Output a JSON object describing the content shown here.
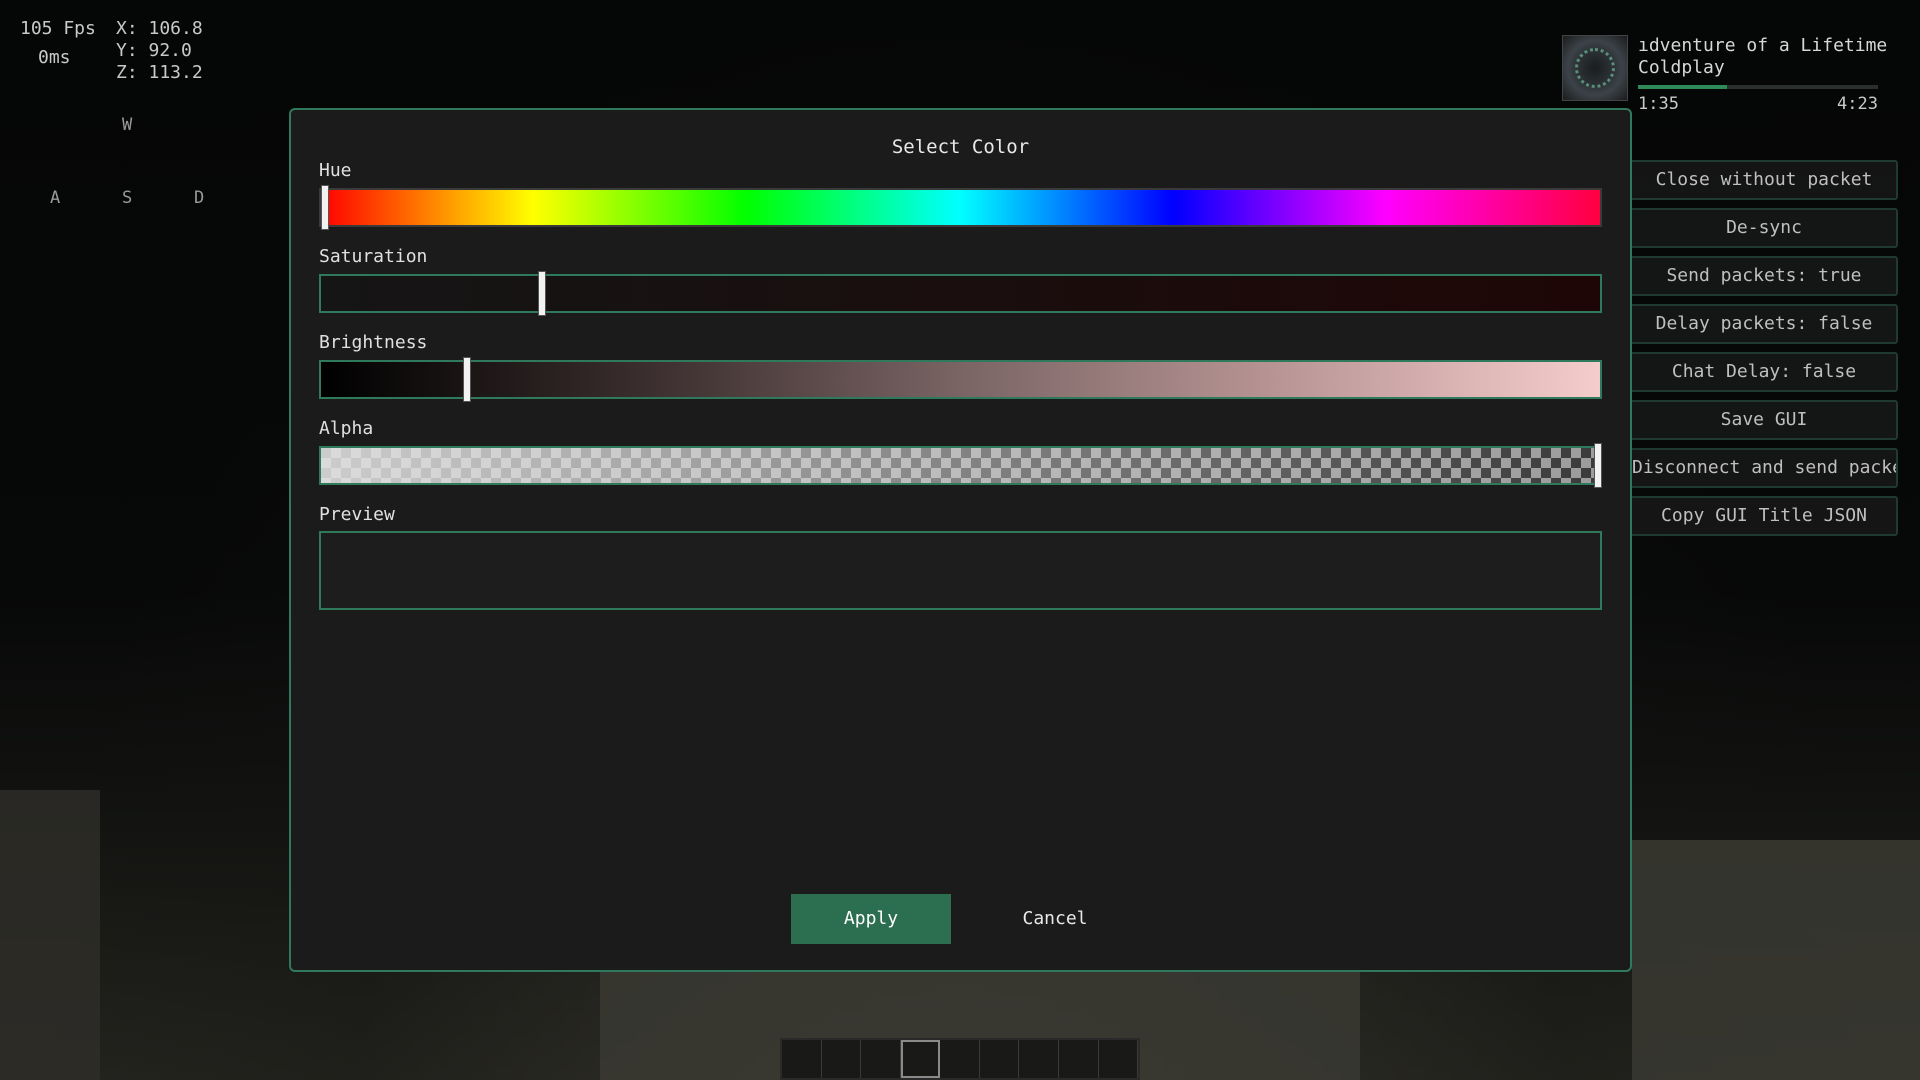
{
  "hud": {
    "fps": "105 Fps",
    "ping": "0ms",
    "coords": {
      "x": "X: 106.8",
      "y": "Y: 92.0",
      "z": "Z: 113.2"
    },
    "keys": {
      "w": "W",
      "a": "A",
      "s": "S",
      "d": "D"
    }
  },
  "music": {
    "title": "ıdventure of a Lifetime",
    "artist": "Coldplay",
    "elapsed": "1:35",
    "total": "4:23",
    "progress": 0.37
  },
  "side_buttons": [
    "Close without packet",
    "De-sync",
    "Send packets: true",
    "Delay packets: false",
    "Chat Delay: false",
    "Save GUI",
    "Disconnect and send packets",
    "Copy GUI Title JSON"
  ],
  "dialog": {
    "title": "Select Color",
    "hue_label": "Hue",
    "saturation_label": "Saturation",
    "brightness_label": "Brightness",
    "alpha_label": "Alpha",
    "preview_label": "Preview",
    "apply_label": "Apply",
    "cancel_label": "Cancel",
    "hue_value": 0.0,
    "saturation_value": 0.172,
    "brightness_value": 0.114,
    "alpha_value": 1.0
  },
  "hotbar": {
    "slots": 9,
    "selected": 3
  },
  "colors": {
    "accent": "#2f7a5c",
    "apply_button": "#2c6e50",
    "dialog_bg": "#1b1b1b",
    "preview_color": "#1d1d1d"
  }
}
